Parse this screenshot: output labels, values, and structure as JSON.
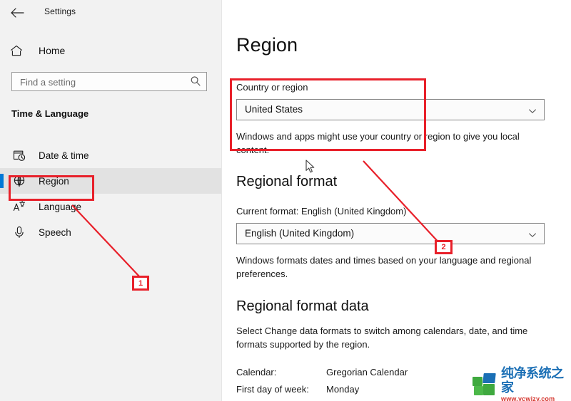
{
  "window": {
    "app_title": "Settings",
    "back_icon": "back-arrow-icon"
  },
  "sidebar": {
    "home": {
      "label": "Home",
      "icon": "home-icon"
    },
    "search": {
      "value": "",
      "placeholder": "Find a setting",
      "icon": "search-icon"
    },
    "group_title": "Time & Language",
    "items": [
      {
        "label": "Date & time",
        "icon": "calendar-clock-icon",
        "selected": false
      },
      {
        "label": "Region",
        "icon": "globe-icon",
        "selected": true
      },
      {
        "label": "Language",
        "icon": "language-icon",
        "selected": false
      },
      {
        "label": "Speech",
        "icon": "microphone-icon",
        "selected": false
      }
    ]
  },
  "main": {
    "page_title": "Region",
    "country": {
      "label": "Country or region",
      "value": "United States",
      "chevron": "chevron-down-icon",
      "description": "Windows and apps might use your country or region to give you local content."
    },
    "regional_format": {
      "heading": "Regional format",
      "current_format": "Current format: English (United Kingdom)",
      "value": "English (United Kingdom)",
      "chevron": "chevron-down-icon",
      "description": "Windows formats dates and times based on your language and regional preferences."
    },
    "regional_format_data": {
      "heading": "Regional format data",
      "description": "Select Change data formats to switch among calendars, date, and time formats supported by the region.",
      "rows": [
        {
          "key": "Calendar:",
          "value": "Gregorian Calendar"
        },
        {
          "key": "First day of week:",
          "value": "Monday"
        }
      ]
    }
  },
  "annotations": {
    "color": "#e8202a",
    "markers": [
      {
        "label": "1"
      },
      {
        "label": "2"
      }
    ]
  },
  "watermark": {
    "name": "纯净系统之家",
    "url": "www.ycwjzy.com"
  }
}
